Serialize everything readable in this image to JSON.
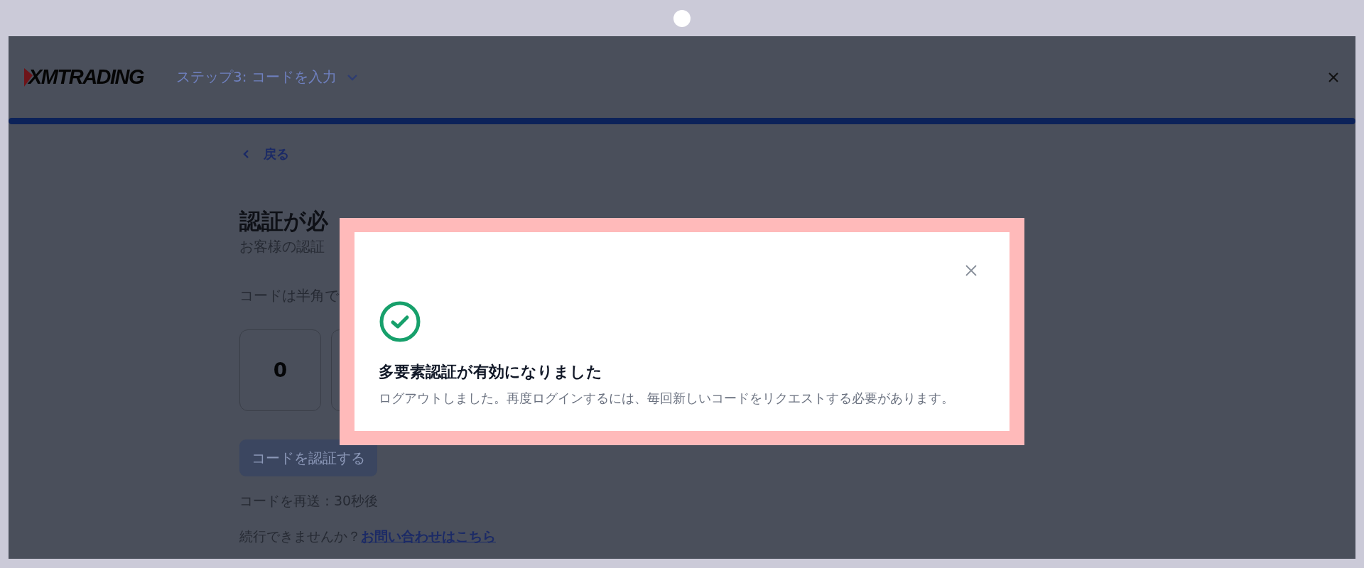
{
  "header": {
    "logo": "XMTRADING",
    "step": "ステップ3: コードを入力"
  },
  "progress": {
    "level": 1
  },
  "back_link": "戻る",
  "page": {
    "title": "認証が必",
    "subtitle": "お客様の認証",
    "code_label": "コードは半角で",
    "code_digits": [
      "0"
    ],
    "verify_button": {
      "label": "コードを認証する",
      "disabled": true
    },
    "resend": "コードを再送：30秒後",
    "help_text": "続行できませんか？",
    "help_link": "お問い合わせはこちら"
  },
  "dialog": {
    "title": "多要素認証が有効になりました",
    "message": "ログアウトしました。再度ログインするには、毎回新しいコードをリクエストする必要があります。"
  }
}
